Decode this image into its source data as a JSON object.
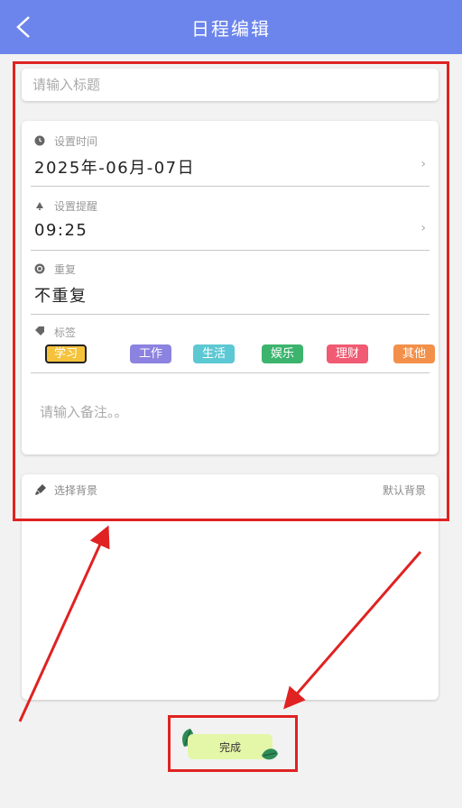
{
  "header": {
    "title": "日程编辑",
    "back_icon": "chevron-left-icon"
  },
  "title_input": {
    "placeholder": "请输入标题",
    "value": ""
  },
  "settings": {
    "date": {
      "label": "设置时间",
      "value": "2025年-06月-07日",
      "icon": "clock-icon"
    },
    "reminder": {
      "label": "设置提醒",
      "value": "09:25",
      "icon": "bell-icon"
    },
    "repeat": {
      "label": "重复",
      "value": "不重复",
      "icon": "repeat-icon"
    },
    "tags": {
      "label": "标签",
      "icon": "tag-icon",
      "selected": "学习",
      "items": [
        {
          "label": "学习",
          "color": "#f5c33b"
        },
        {
          "label": "工作",
          "color": "#8c82e0"
        },
        {
          "label": "生活",
          "color": "#5cc8d3"
        },
        {
          "label": "娱乐",
          "color": "#3cb46e"
        },
        {
          "label": "理财",
          "color": "#f05a72"
        },
        {
          "label": "其他",
          "color": "#f2904a"
        }
      ]
    },
    "note": {
      "placeholder": "请输入备注。。",
      "value": ""
    }
  },
  "background": {
    "label": "选择背景",
    "default_label": "默认背景",
    "icon": "brush-icon"
  },
  "done_button": {
    "label": "完成"
  },
  "colors": {
    "header": "#6c85ec",
    "annotation": "#e02222",
    "done_bg": "#e4f6a8"
  }
}
